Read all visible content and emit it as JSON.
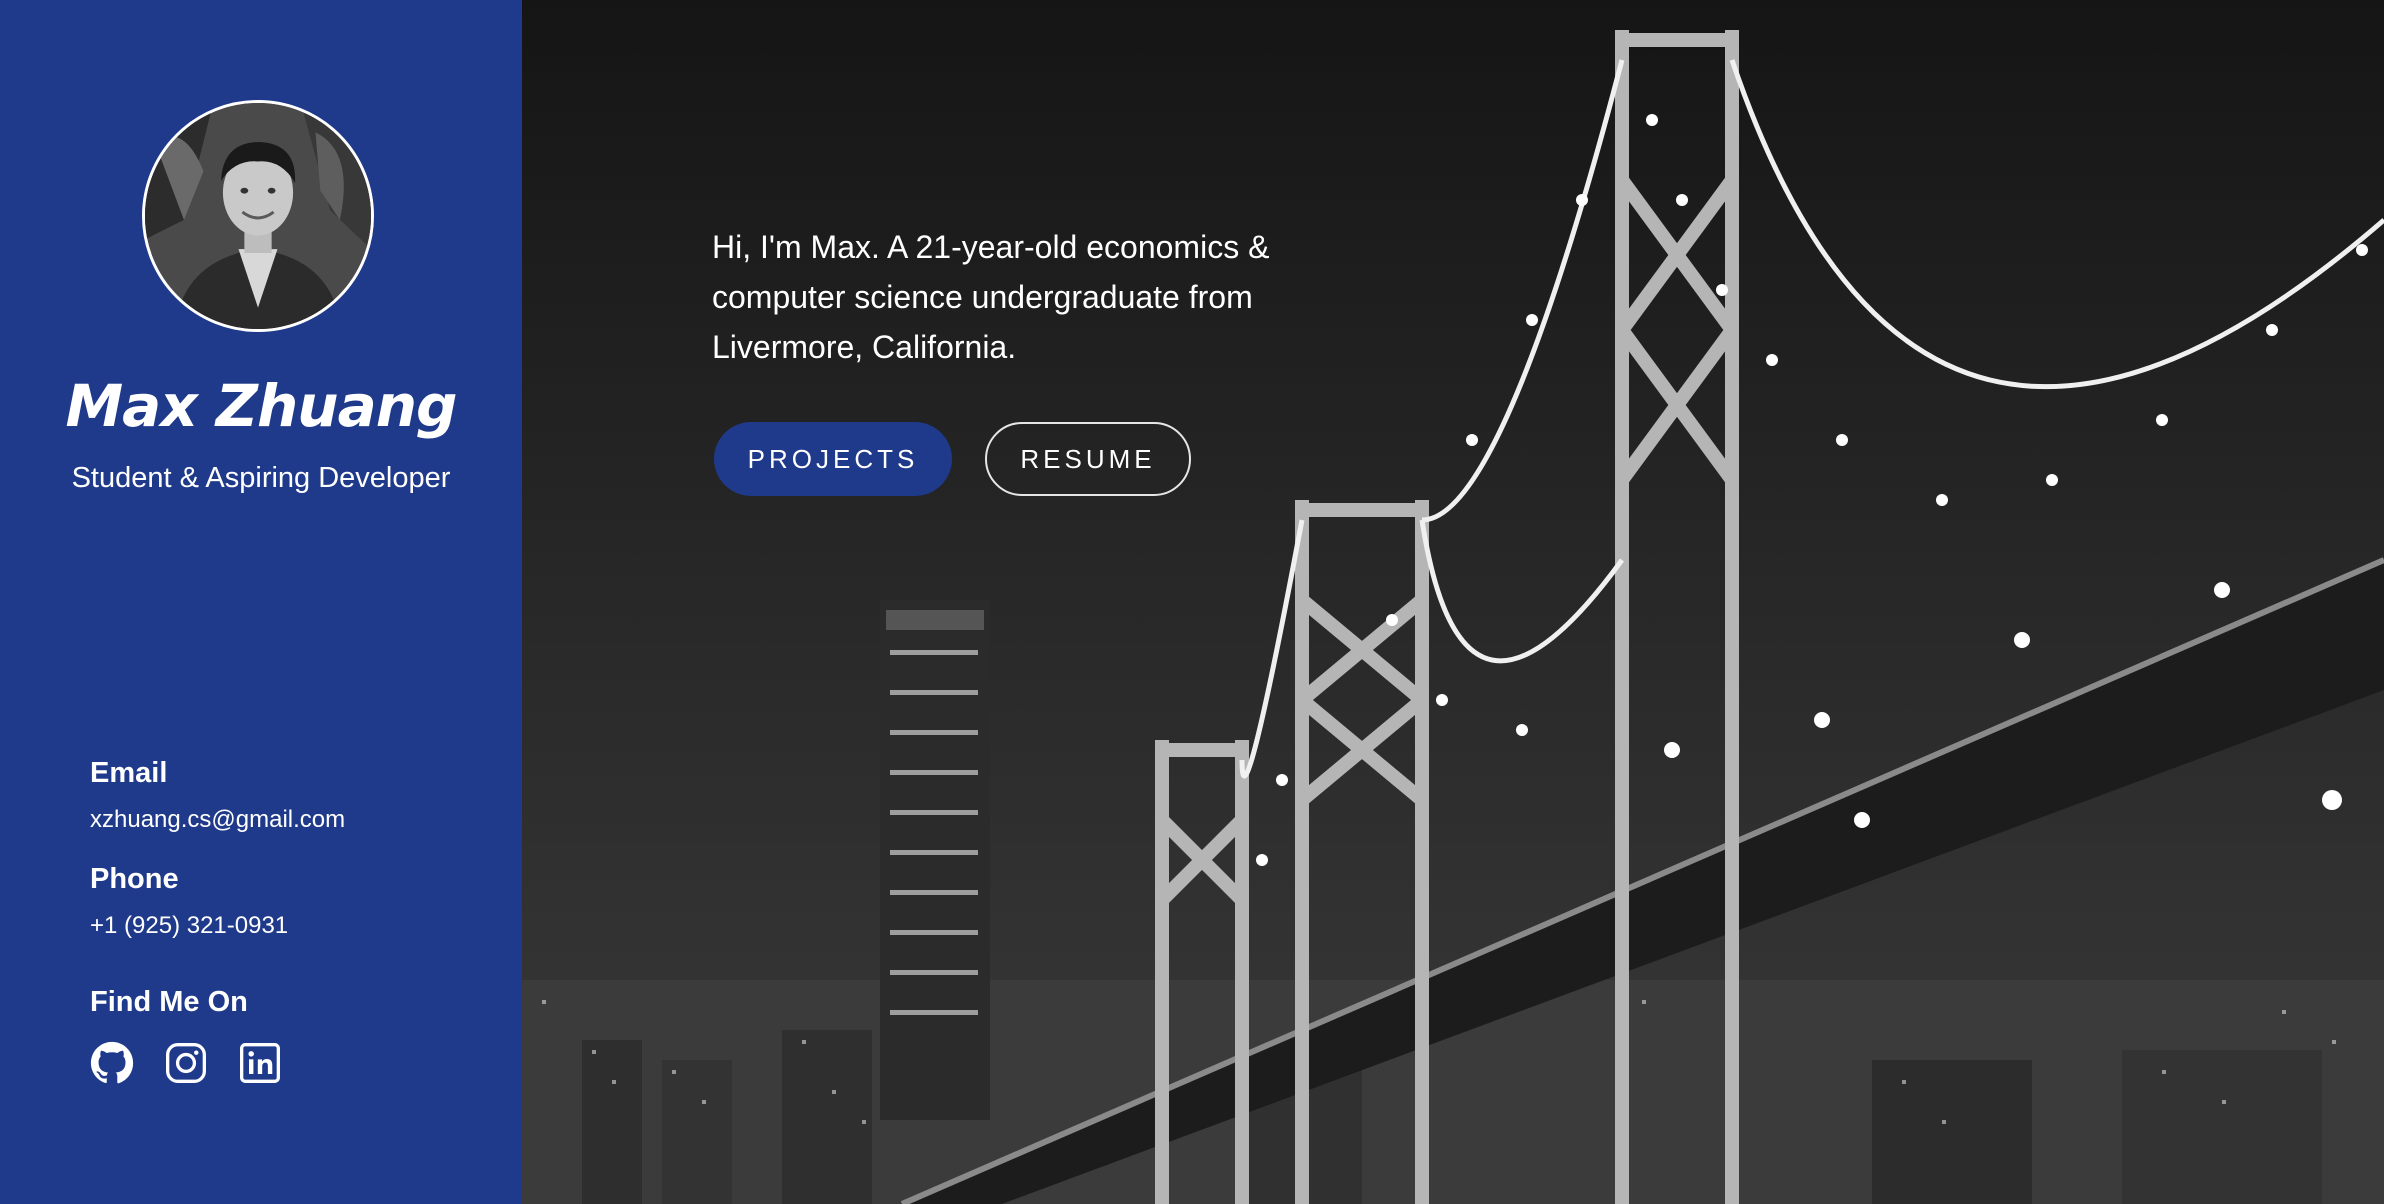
{
  "sidebar": {
    "name": "Max Zhuang",
    "subtitle": "Student & Aspiring Developer",
    "avatar_alt": "Profile photo of Max Zhuang",
    "email": {
      "label": "Email",
      "value": "xzhuang.cs@gmail.com"
    },
    "phone": {
      "label": "Phone",
      "value": "+1 (925) 321-0931"
    },
    "social": {
      "label": "Find Me On",
      "icons": [
        "github-icon",
        "instagram-icon",
        "linkedin-icon"
      ]
    }
  },
  "hero": {
    "intro": "Hi, I'm Max. A 21-year-old economics & computer science undergraduate from Livermore, California.",
    "buttons": {
      "projects": "PROJECTS",
      "resume": "RESUME"
    }
  },
  "colors": {
    "sidebar_bg": "#1f3a8a",
    "primary_button": "#1f3a8a",
    "text": "#ffffff"
  }
}
